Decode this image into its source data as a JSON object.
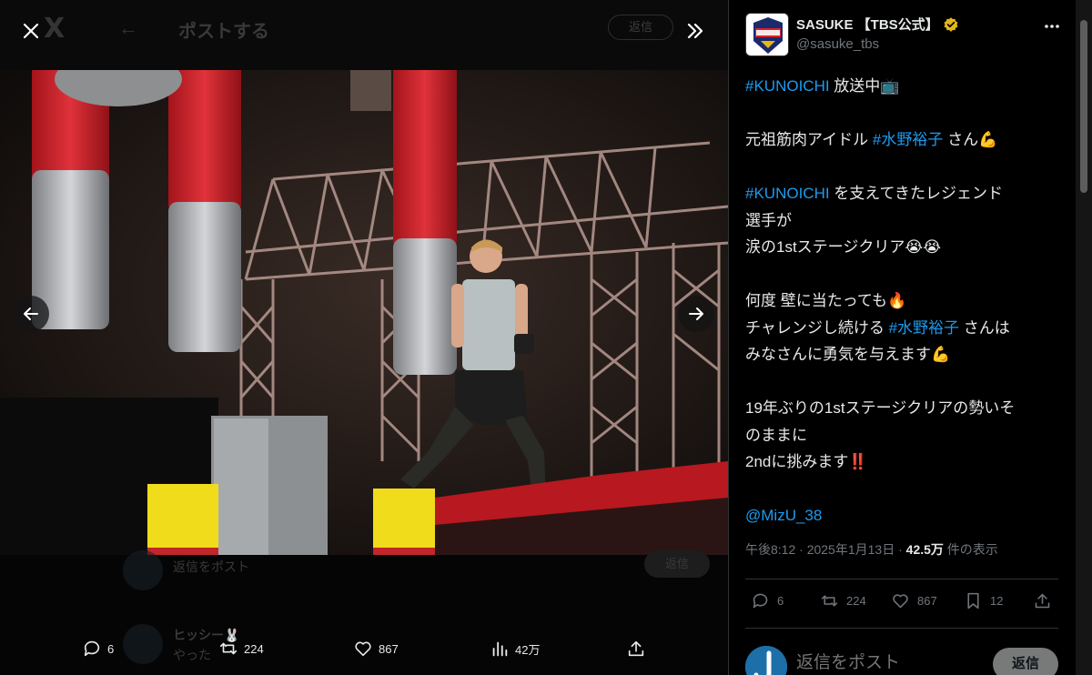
{
  "viewer": {
    "background": {
      "logo": "X",
      "back_arrow": "←",
      "title": "ポストする",
      "reply_button": "返信",
      "row1_text": "返信をポスト",
      "row1_button": "返信",
      "row2_name": "ヒッシー🐰",
      "row2_text": "やった"
    },
    "close_icon": "close-icon",
    "expand_icon": "chevrons-right-icon",
    "actions": {
      "replies": "6",
      "retweets": "224",
      "likes": "867",
      "views": "42万"
    }
  },
  "tweet": {
    "display_name": "SASUKE 【TBS公式】",
    "handle": "@sasuke_tbs",
    "verified_color": "#e2b719",
    "lines": [
      {
        "segments": [
          {
            "text": "#KUNOICHI",
            "tag": true
          },
          {
            "text": " 放送中📺",
            "tag": false
          }
        ]
      },
      {
        "gap": true
      },
      {
        "segments": [
          {
            "text": "元祖筋肉アイドル ",
            "tag": false
          },
          {
            "text": "#水野裕子",
            "tag": true
          },
          {
            "text": " さん💪",
            "tag": false
          }
        ]
      },
      {
        "gap": true
      },
      {
        "segments": [
          {
            "text": "#KUNOICHI",
            "tag": true
          },
          {
            "text": " を支えてきたレジェンド",
            "tag": false
          }
        ]
      },
      {
        "segments": [
          {
            "text": "選手が",
            "tag": false
          }
        ]
      },
      {
        "segments": [
          {
            "text": "涙の1stステージクリア😭😭",
            "tag": false
          }
        ]
      },
      {
        "gap": true
      },
      {
        "segments": [
          {
            "text": "何度 壁に当たっても🔥",
            "tag": false
          }
        ]
      },
      {
        "segments": [
          {
            "text": "チャレンジし続ける ",
            "tag": false
          },
          {
            "text": "#水野裕子",
            "tag": true
          },
          {
            "text": " さんは",
            "tag": false
          }
        ]
      },
      {
        "segments": [
          {
            "text": "みなさんに勇気を与えます💪",
            "tag": false
          }
        ]
      },
      {
        "gap": true
      },
      {
        "segments": [
          {
            "text": "19年ぶりの1stステージクリアの勢いそ",
            "tag": false
          }
        ]
      },
      {
        "segments": [
          {
            "text": "のままに",
            "tag": false
          }
        ]
      },
      {
        "segments": [
          {
            "text": "2ndに挑みます‼️",
            "tag": false
          }
        ]
      },
      {
        "gap": true
      },
      {
        "segments": [
          {
            "text": "@MizU_38",
            "tag": true
          }
        ]
      }
    ],
    "meta": {
      "time": "午後8:12",
      "sep1": " · ",
      "date": "2025年1月13日",
      "sep2": " · ",
      "views_count": "42.5万",
      "views_label": " 件の表示"
    },
    "actions": {
      "replies": "6",
      "retweets": "224",
      "likes": "867",
      "bookmarks": "12"
    },
    "reply": {
      "placeholder": "返信をポスト",
      "button": "返信"
    }
  },
  "colors": {
    "accent": "#1d9bf0",
    "muted": "#71767b",
    "text": "#e7e9ea"
  }
}
